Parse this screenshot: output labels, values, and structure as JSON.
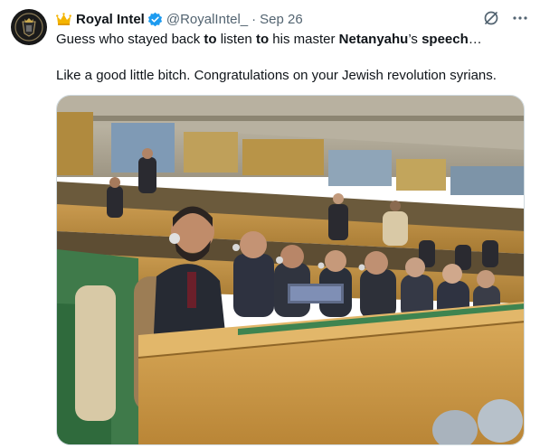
{
  "tweet": {
    "author_name": "Royal Intel",
    "author_handle": "@RoyalIntel_",
    "separator": "·",
    "date": "Sep 26",
    "icons": {
      "name_badge": "crown-icon",
      "verified": "verified-badge-icon",
      "grok": "grok-icon",
      "more": "more-options-icon"
    },
    "line1": [
      {
        "text": "Guess who stayed back ",
        "bold": false
      },
      {
        "text": "to",
        "bold": true
      },
      {
        "text": " listen ",
        "bold": false
      },
      {
        "text": "to",
        "bold": true
      },
      {
        "text": " his master ",
        "bold": false
      },
      {
        "text": "Netanyahu",
        "bold": true
      },
      {
        "text": "’s ",
        "bold": false
      },
      {
        "text": "speech",
        "bold": true
      },
      {
        "text": "…",
        "bold": false
      }
    ],
    "line2": "Like a good little bitch. Congratulations on your Jewish revolution syrians.",
    "media": {
      "type": "photo",
      "subject": "delegates-seated-in-assembly-hall"
    },
    "colors": {
      "verified_blue": "#1d9bf0",
      "secondary_text": "#536471",
      "primary_text": "#0f1419",
      "border": "#cfd9de"
    }
  }
}
